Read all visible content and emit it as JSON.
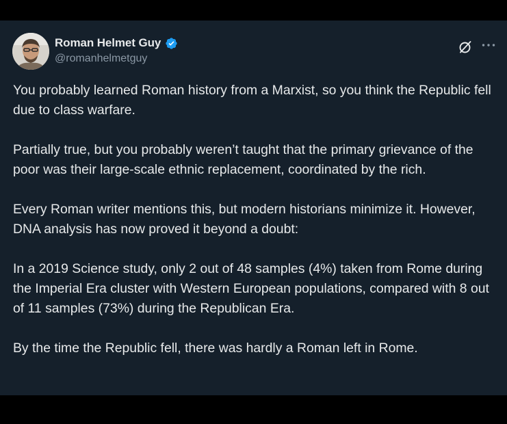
{
  "post": {
    "display_name": "Roman Helmet Guy",
    "handle": "@romanhelmetguy",
    "verified": true,
    "icons": {
      "verified": "verified-badge-icon",
      "grok": "grok-slash-circle-icon",
      "more": "more-horizontal-icon"
    },
    "paragraphs": [
      "You probably learned Roman history from a Marxist, so you think the Republic fell due to class warfare.",
      "Partially true, but you probably weren’t taught that the primary grievance of the poor was their large-scale ethnic replacement, coordinated by the rich.",
      "Every Roman writer mentions this, but modern historians minimize it. However, DNA analysis has now proved it beyond a doubt:",
      "In a 2019 Science study, only 2 out of 48 samples (4%) taken from Rome during the Imperial Era cluster with Western European populations, compared with 8 out of 11 samples (73%) during the Republican Era.",
      "By the time the Republic fell, there was hardly a Roman left in Rome."
    ]
  },
  "colors": {
    "background": "#15202b",
    "text_primary": "#e7e9ea",
    "text_secondary": "#8b98a5",
    "verified_blue": "#1d9bf0"
  }
}
